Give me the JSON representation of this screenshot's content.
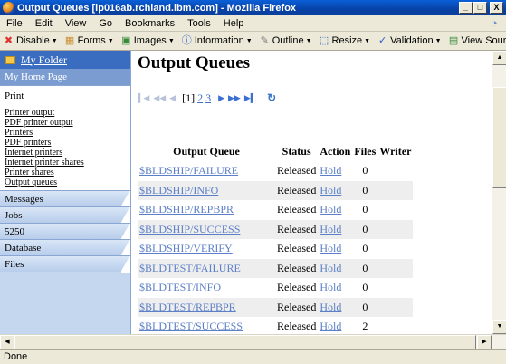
{
  "window": {
    "title": "Output Queues [lp016ab.rchland.ibm.com] - Mozilla Firefox",
    "minimize": "_",
    "maximize": "□",
    "close": "X"
  },
  "menu": [
    "File",
    "Edit",
    "View",
    "Go",
    "Bookmarks",
    "Tools",
    "Help"
  ],
  "toolbar": [
    {
      "label": "Disable",
      "icon": "disable-icon",
      "glyph": "✖"
    },
    {
      "label": "Forms",
      "icon": "forms-icon",
      "glyph": "▦"
    },
    {
      "label": "Images",
      "icon": "images-icon",
      "glyph": "▣"
    },
    {
      "label": "Information",
      "icon": "information-icon",
      "glyph": "ⓘ"
    },
    {
      "label": "Outline",
      "icon": "outline-icon",
      "glyph": "✎"
    },
    {
      "label": "Resize",
      "icon": "resize-icon",
      "glyph": "⬚"
    },
    {
      "label": "Validation",
      "icon": "validation-icon",
      "glyph": "✓"
    },
    {
      "label": "View Source",
      "icon": "view-source-icon",
      "glyph": "▤"
    }
  ],
  "sidebar": {
    "folder": "My Folder",
    "home": "My Home Page",
    "print_heading": "Print",
    "print_items": [
      "Printer output",
      "PDF printer output",
      "Printers",
      "PDF printers",
      "Internet printers",
      "Internet printer shares",
      "Printer shares",
      "Output queues"
    ],
    "categories": [
      "Messages",
      "Jobs",
      "5250",
      "Database",
      "Files"
    ]
  },
  "page": {
    "title": "Output Queues",
    "pager": {
      "current": "[1]",
      "pages": [
        "2",
        "3"
      ]
    }
  },
  "table": {
    "headers": [
      "Output Queue",
      "Status",
      "Action",
      "Files",
      "Writer"
    ],
    "rows": [
      {
        "queue": "$BLDSHIP/FAILURE",
        "status": "Released",
        "action": "Hold",
        "files": "0",
        "writer": ""
      },
      {
        "queue": "$BLDSHIP/INFO",
        "status": "Released",
        "action": "Hold",
        "files": "0",
        "writer": ""
      },
      {
        "queue": "$BLDSHIP/REPBPR",
        "status": "Released",
        "action": "Hold",
        "files": "0",
        "writer": ""
      },
      {
        "queue": "$BLDSHIP/SUCCESS",
        "status": "Released",
        "action": "Hold",
        "files": "0",
        "writer": ""
      },
      {
        "queue": "$BLDSHIP/VERIFY",
        "status": "Released",
        "action": "Hold",
        "files": "0",
        "writer": ""
      },
      {
        "queue": "$BLDTEST/FAILURE",
        "status": "Released",
        "action": "Hold",
        "files": "0",
        "writer": ""
      },
      {
        "queue": "$BLDTEST/INFO",
        "status": "Released",
        "action": "Hold",
        "files": "0",
        "writer": ""
      },
      {
        "queue": "$BLDTEST/REPBPR",
        "status": "Released",
        "action": "Hold",
        "files": "0",
        "writer": ""
      },
      {
        "queue": "$BLDTEST/SUCCESS",
        "status": "Released",
        "action": "Hold",
        "files": "2",
        "writer": ""
      }
    ]
  },
  "status_bar": "Done"
}
